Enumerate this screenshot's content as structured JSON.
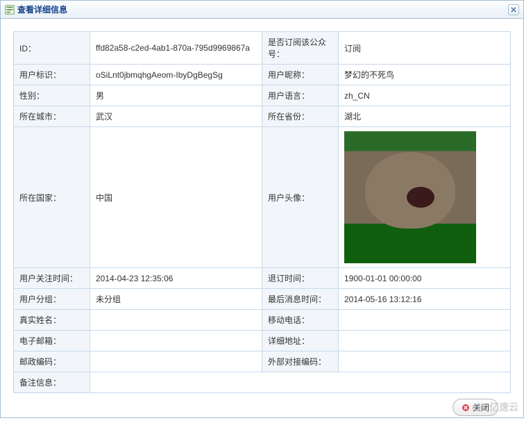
{
  "dialog": {
    "title": "查看详细信息",
    "close_button_label": "关闭"
  },
  "fields": {
    "id": {
      "label": "ID：",
      "value": "ffd82a58-c2ed-4ab1-870a-795d9969867a"
    },
    "is_subscribed": {
      "label": "是否订阅该公众号：",
      "value": "订阅"
    },
    "user_openid": {
      "label": "用户标识：",
      "value": "oSiLnt0jbmqhgAeom-IbyDgBegSg"
    },
    "nickname": {
      "label": "用户昵称：",
      "value": "梦幻的不死鸟"
    },
    "gender": {
      "label": "性别：",
      "value": "男"
    },
    "language": {
      "label": "用户语言：",
      "value": "zh_CN"
    },
    "city": {
      "label": "所在城市：",
      "value": "武汉"
    },
    "province": {
      "label": "所在省份：",
      "value": "湖北"
    },
    "country": {
      "label": "所在国家：",
      "value": "中国"
    },
    "avatar": {
      "label": "用户头像：",
      "value": ""
    },
    "subscribe_time": {
      "label": "用户关注时间：",
      "value": "2014-04-23 12:35:06"
    },
    "unsubscribe_time": {
      "label": "退订时间：",
      "value": "1900-01-01 00:00:00"
    },
    "group": {
      "label": "用户分组：",
      "value": "未分组"
    },
    "last_msg_time": {
      "label": "最后消息时间：",
      "value": "2014-05-16 13:12:16"
    },
    "real_name": {
      "label": "真实姓名：",
      "value": ""
    },
    "mobile": {
      "label": "移动电话：",
      "value": ""
    },
    "email": {
      "label": "电子邮箱：",
      "value": ""
    },
    "address": {
      "label": "详细地址：",
      "value": ""
    },
    "postcode": {
      "label": "邮政编码：",
      "value": ""
    },
    "external_code": {
      "label": "外部对接编码：",
      "value": ""
    },
    "remark": {
      "label": "备注信息：",
      "value": ""
    }
  },
  "watermark": "亿速云"
}
